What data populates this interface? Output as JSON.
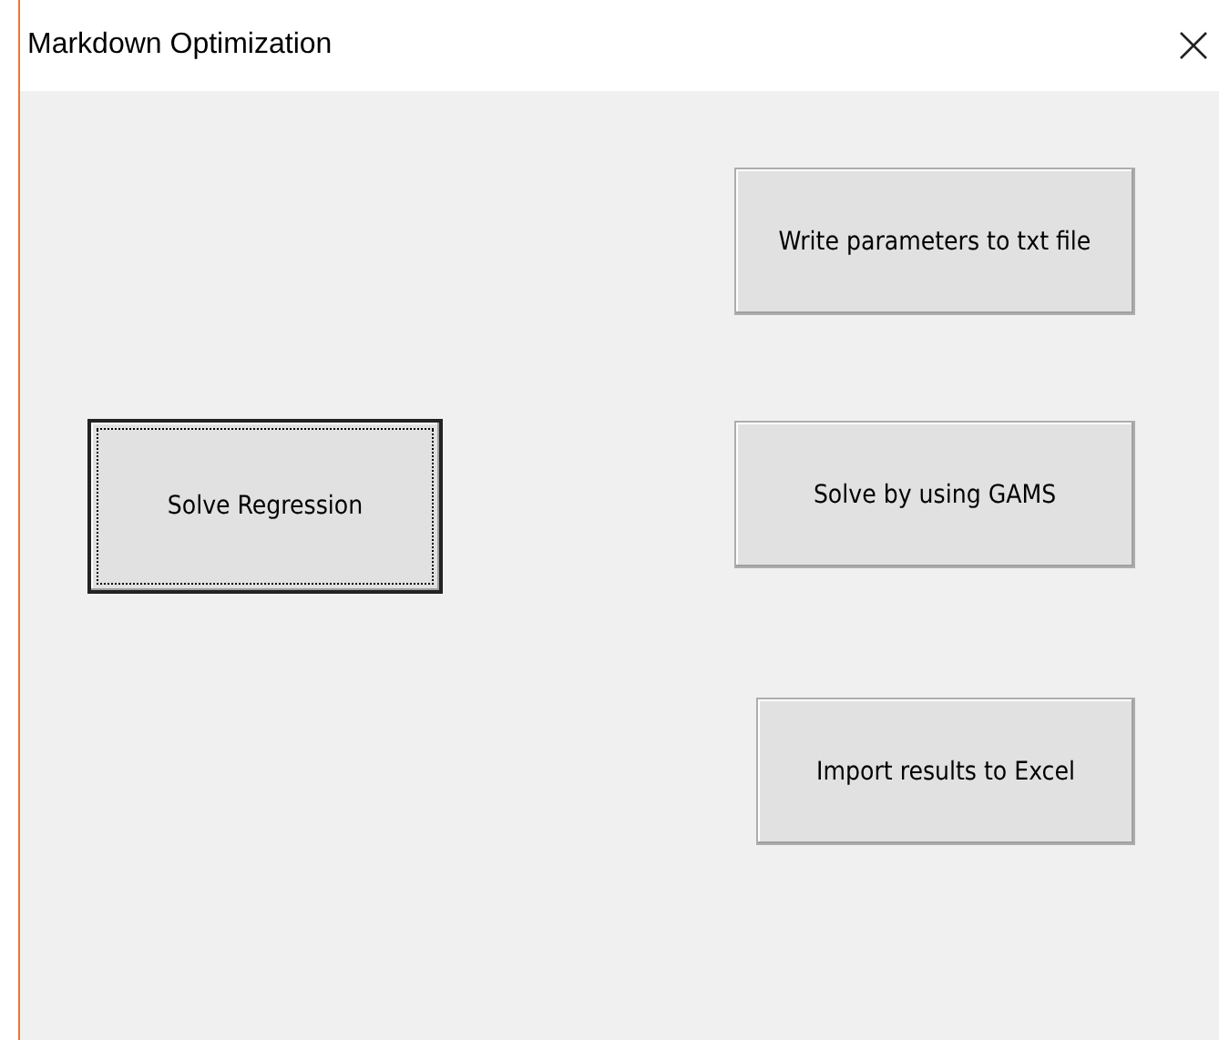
{
  "window": {
    "title": "Markdown Optimization"
  },
  "left_buttons": [
    {
      "label": "Solve Regression",
      "focused": true
    }
  ],
  "right_buttons": [
    {
      "label": "Write parameters to txt file",
      "focused": false
    },
    {
      "label": "Solve by using GAMS",
      "focused": false
    },
    {
      "label": "Import results to Excel",
      "focused": false
    }
  ]
}
